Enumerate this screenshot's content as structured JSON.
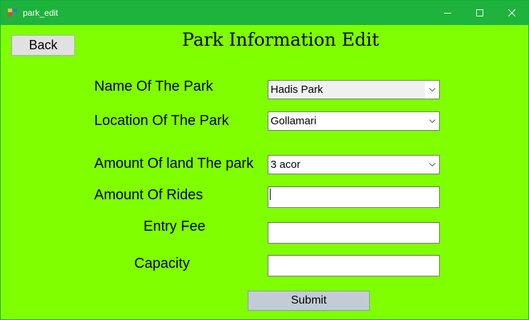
{
  "window": {
    "title": "park_edit",
    "icon": "app-window-icon",
    "controls": [
      "minimize-icon",
      "maximize-icon",
      "close-icon"
    ]
  },
  "header": {
    "back_label": "Back",
    "title": "Park Information Edit"
  },
  "form": {
    "name_label": "Name Of The Park",
    "name_value": "Hadis Park",
    "location_label": "Location Of The Park",
    "location_value": "Gollamari",
    "land_label": "Amount Of land The park",
    "land_value": "3 acor",
    "rides_label": "Amount Of Rides",
    "rides_value": "",
    "fee_label": "Entry Fee",
    "fee_value": "",
    "capacity_label": "Capacity",
    "capacity_value": "",
    "submit_label": "Submit"
  },
  "colors": {
    "background": "#7fff00",
    "titlebar": "#1db33c",
    "button": "#e1e1e1",
    "submit_button": "#c3ccd6"
  }
}
